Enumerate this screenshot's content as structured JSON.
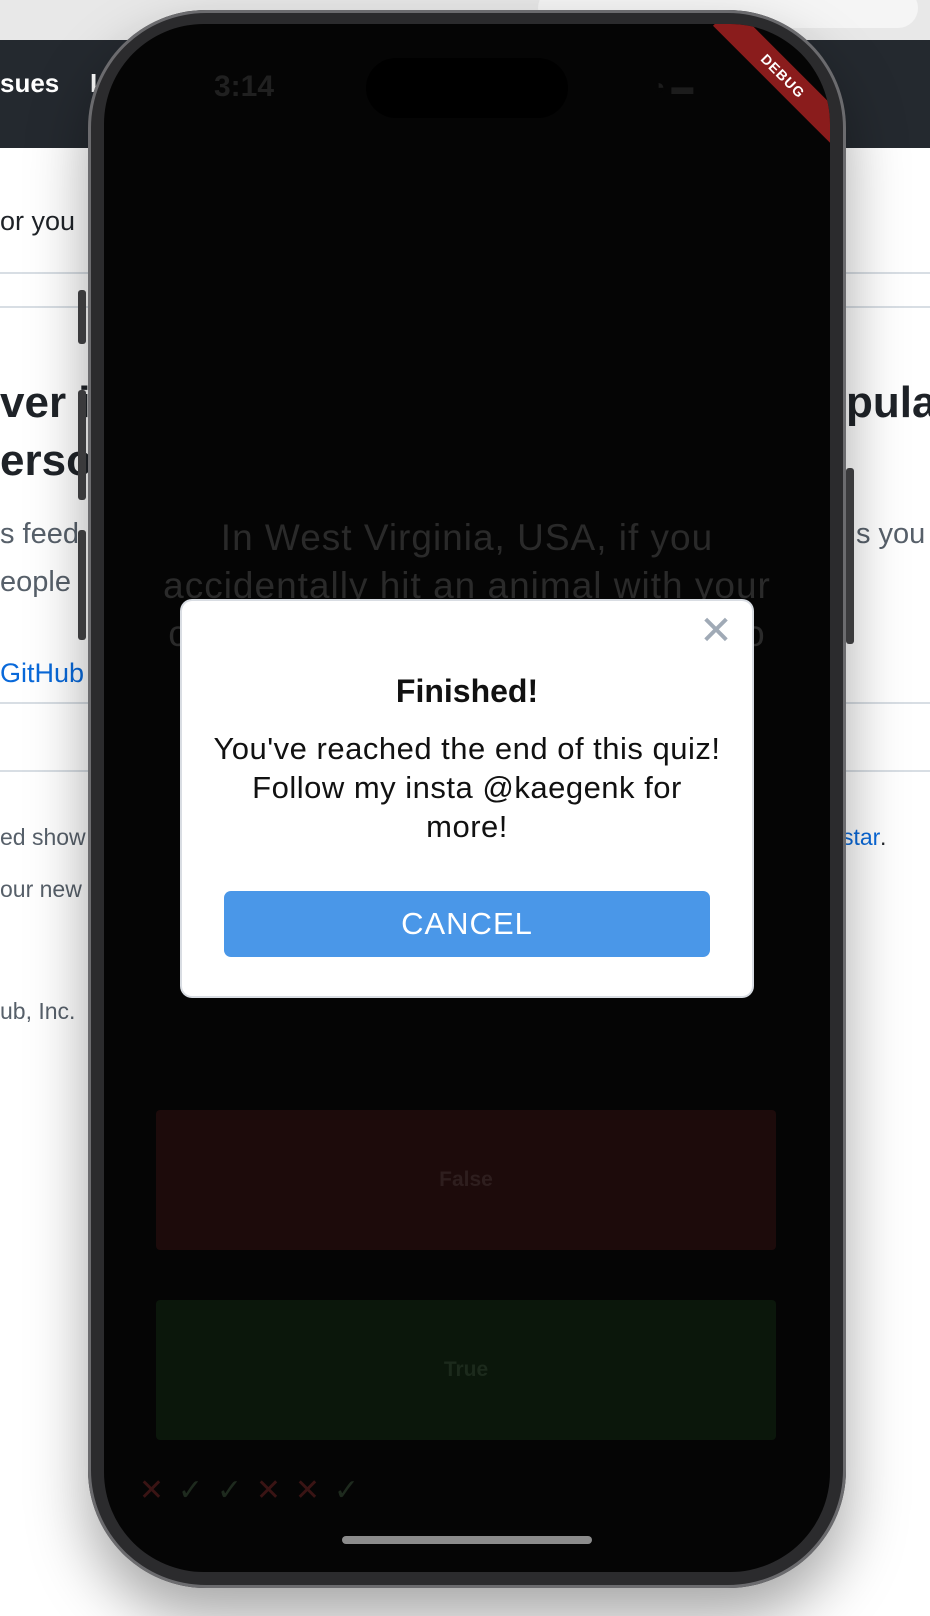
{
  "background_page": {
    "nav_left": "sues",
    "nav_right": "I",
    "line1": "or you",
    "heading_left_1": "ver i",
    "heading_left_2": "erso",
    "heading_right_1": "pula",
    "feed_left": "s feed",
    "feed_right": "s you",
    "people": "eople",
    "github_link": "GitHub",
    "shown_left": "ed show",
    "star_link": "star",
    "star_period": ".",
    "news_left": "our new",
    "company": "ub, Inc."
  },
  "status_bar": {
    "time": "3:14",
    "icons": "◔ ▬"
  },
  "debug_banner": "DEBUG",
  "quiz": {
    "question": "In West Virginia, USA, if you accidentally hit an animal with your car, you are free to take it home to eat",
    "answers": {
      "false_label": "False",
      "true_label": "True"
    },
    "score_marks": [
      "✕",
      "✓",
      "✓",
      "✕",
      "✕",
      "✓"
    ]
  },
  "dialog": {
    "close_symbol": "✕",
    "title": "Finished!",
    "description": "You've reached the end of this quiz! Follow my insta @kaegenk for more!",
    "cancel_label": "CANCEL"
  }
}
